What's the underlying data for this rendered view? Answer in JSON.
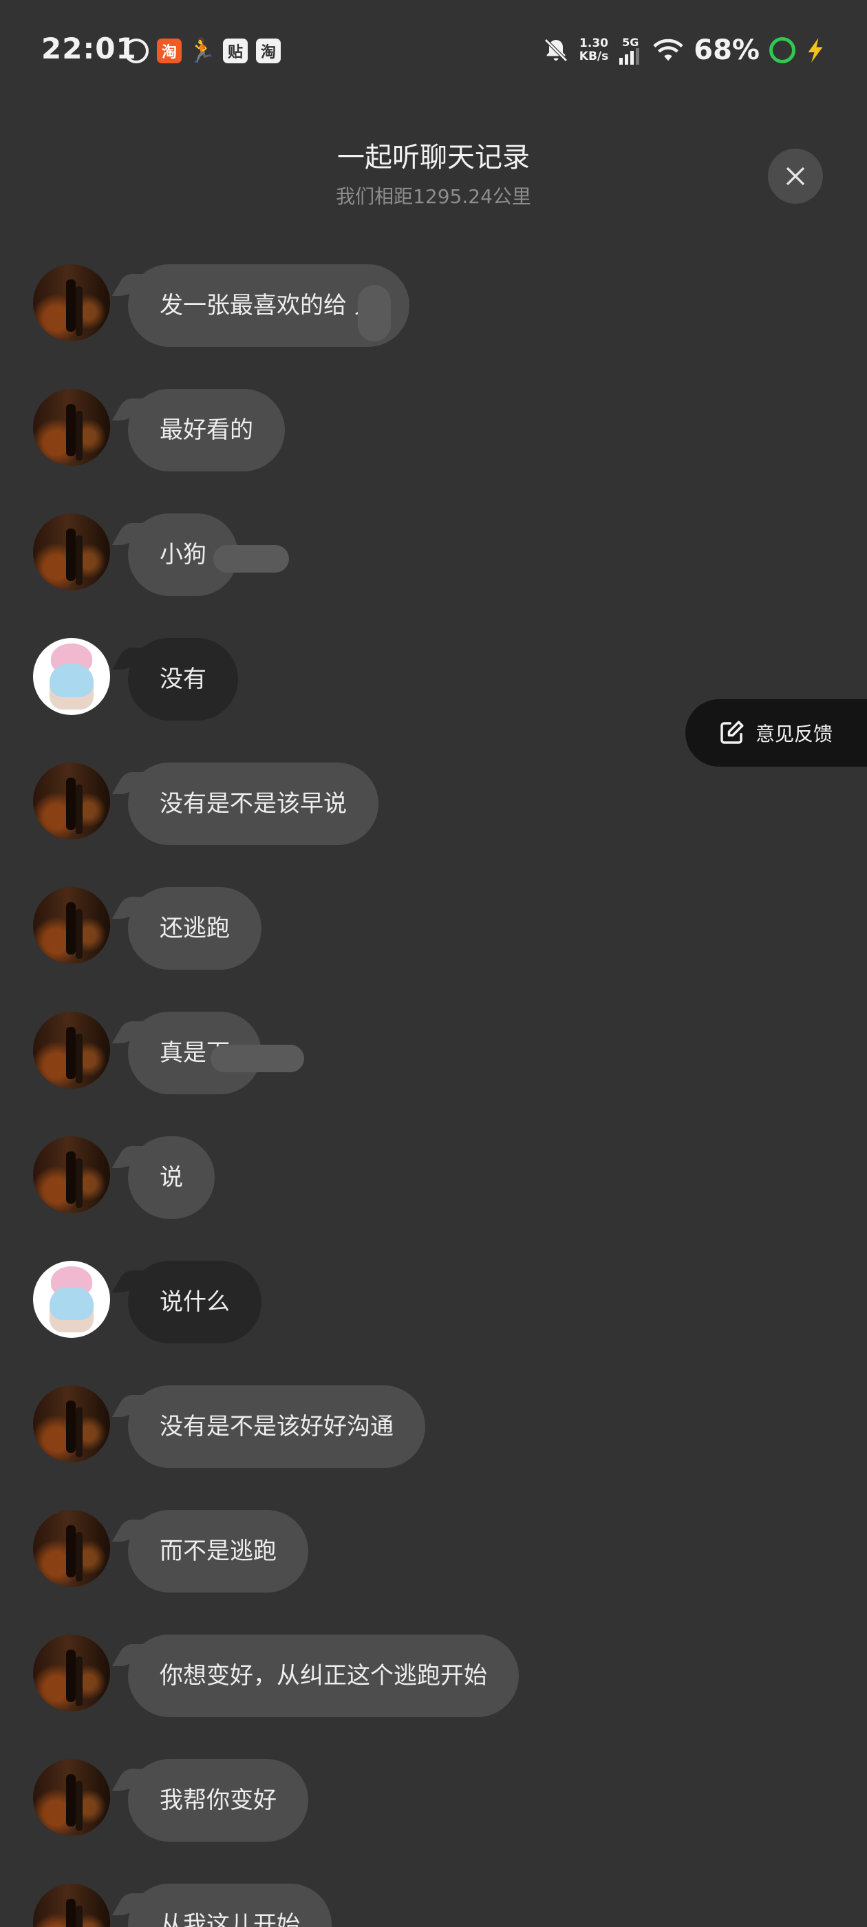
{
  "status_bar": {
    "time": "22:01",
    "app_icons": [
      "weibo-icon",
      "taobao-like-icon",
      "person-icon",
      "tieba-icon",
      "taobao-icon"
    ],
    "app_icon_glyphs": {
      "taobao_like": "淘",
      "tieba": "贴",
      "taobao": "淘"
    },
    "net_speed_value": "1.30",
    "net_speed_unit": "KB/s",
    "network_type": "5G",
    "battery_percent": "68%"
  },
  "header": {
    "title": "一起听聊天记录",
    "subtitle": "我们相距1295.24公里"
  },
  "feedback": {
    "label": "意见反馈"
  },
  "messages": [
    {
      "sender": "other",
      "text": "发一张最喜欢的给  人"
    },
    {
      "sender": "other",
      "text": "最好看的"
    },
    {
      "sender": "other",
      "text": "小狗"
    },
    {
      "sender": "me",
      "text": "没有"
    },
    {
      "sender": "other",
      "text": "没有是不是该早说"
    },
    {
      "sender": "other",
      "text": "还逃跑"
    },
    {
      "sender": "other",
      "text": "真是下"
    },
    {
      "sender": "other",
      "text": "说"
    },
    {
      "sender": "me",
      "text": "说什么"
    },
    {
      "sender": "other",
      "text": "没有是不是该好好沟通"
    },
    {
      "sender": "other",
      "text": "而不是逃跑"
    },
    {
      "sender": "other",
      "text": "你想变好，从纠正这个逃跑开始"
    },
    {
      "sender": "other",
      "text": "我帮你变好"
    },
    {
      "sender": "other",
      "text": "从我这儿开始"
    }
  ],
  "colors": {
    "background": "#333333",
    "bubble_other": "#4d4d4d",
    "bubble_me": "#262626",
    "feedback_bg": "#141414",
    "charging_ring": "#32c850",
    "bolt": "#f5c518"
  }
}
